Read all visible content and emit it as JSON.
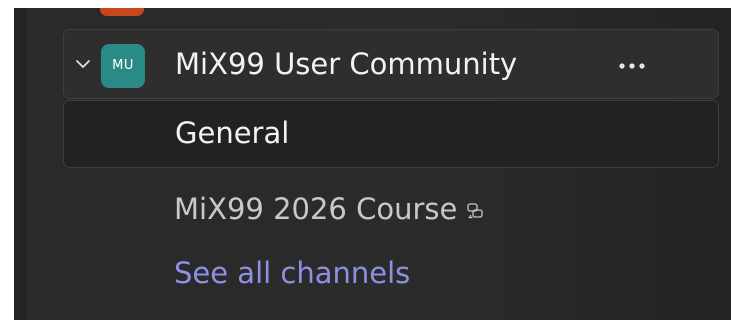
{
  "team": {
    "avatar_initials": "MU",
    "name": "MiX99 User Community",
    "avatar_color": "#2a8a86"
  },
  "channels": [
    {
      "label": "General",
      "selected": true
    },
    {
      "label": "MiX99 2026 Course",
      "shared": true
    }
  ],
  "see_all_label": "See all channels",
  "colors": {
    "link": "#8d91e6",
    "panel": "#2b2b2b",
    "previous_team_avatar": "#c8471e"
  },
  "icons": {
    "expand": "chevron-down-icon",
    "more": "more-options-icon",
    "shared_channel": "shared-channel-icon"
  }
}
